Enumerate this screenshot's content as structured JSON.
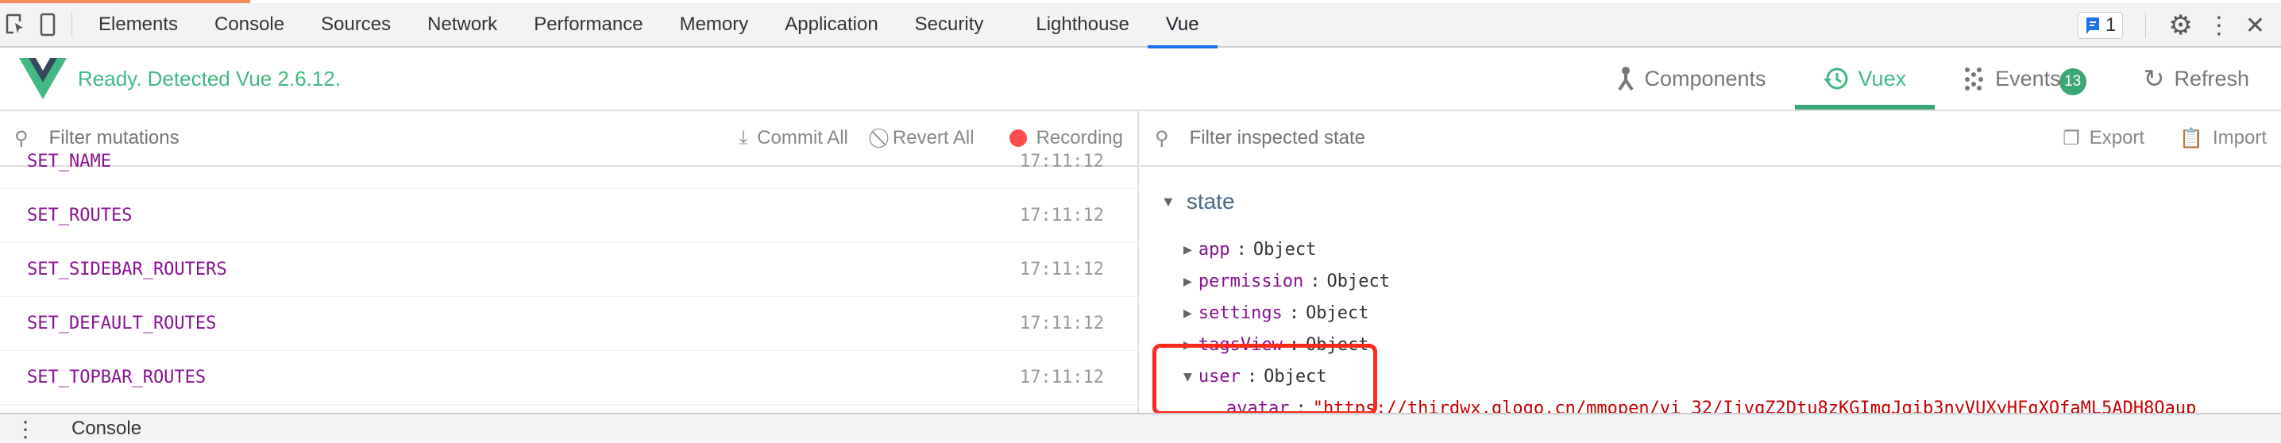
{
  "devtools": {
    "tabs": [
      "Elements",
      "Console",
      "Sources",
      "Network",
      "Performance",
      "Memory",
      "Application",
      "Security",
      "Lighthouse",
      "Vue"
    ],
    "active_tab": "Vue",
    "issues_count": "1"
  },
  "vue": {
    "status": "Ready. Detected Vue 2.6.12.",
    "nav": [
      {
        "label": "Components",
        "icon": "components-icon"
      },
      {
        "label": "Vuex",
        "icon": "history-icon"
      },
      {
        "label": "Events",
        "icon": "events-icon"
      },
      {
        "label": "Refresh",
        "icon": "refresh-icon"
      }
    ],
    "events_badge": "13",
    "active_nav": "Vuex",
    "accent": "#42b983"
  },
  "mutations": {
    "filter_placeholder": "Filter mutations",
    "commit_all": "Commit All",
    "revert_all": "Revert All",
    "recording": "Recording",
    "rows": [
      {
        "name": "SET_NAME",
        "time": "17:11:12"
      },
      {
        "name": "SET_ROUTES",
        "time": "17:11:12"
      },
      {
        "name": "SET_SIDEBAR_ROUTERS",
        "time": "17:11:12"
      },
      {
        "name": "SET_DEFAULT_ROUTES",
        "time": "17:11:12"
      },
      {
        "name": "SET_TOPBAR_ROUTES",
        "time": "17:11:12"
      }
    ]
  },
  "state": {
    "filter_placeholder": "Filter inspected state",
    "export": "Export",
    "import": "Import",
    "root": "state",
    "props": [
      {
        "key": "app",
        "value": "Object"
      },
      {
        "key": "permission",
        "value": "Object"
      },
      {
        "key": "settings",
        "value": "Object"
      },
      {
        "key": "tagsView",
        "value": "Object"
      },
      {
        "key": "user",
        "value": "Object"
      }
    ],
    "avatar_key": "avatar",
    "avatar_value": "\"https://thirdwx.qlogo.cn/mmopen/vi_32/IjvqZ2Dtu8zKGImqJgib3nyVUXyHFgXQfaML5ADH8Qaup"
  },
  "drawer": {
    "label": "Console"
  }
}
